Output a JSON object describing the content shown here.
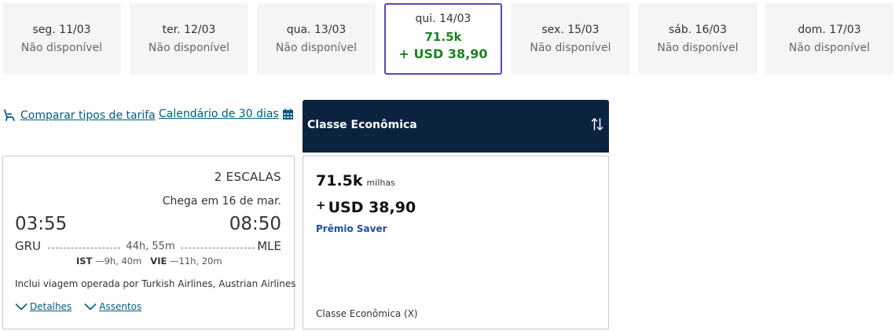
{
  "dates": [
    {
      "label": "seg. 11/03",
      "status": "Não disponível"
    },
    {
      "label": "ter. 12/03",
      "status": "Não disponível"
    },
    {
      "label": "qua. 13/03",
      "status": "Não disponível"
    },
    {
      "label": "qui. 14/03",
      "miles": "71.5k",
      "price": "+ USD 38,90",
      "selected": true
    },
    {
      "label": "sex. 15/03",
      "status": "Não disponível"
    },
    {
      "label": "sáb. 16/03",
      "status": "Não disponível"
    },
    {
      "label": "dom. 17/03",
      "status": "Não disponível"
    }
  ],
  "links": {
    "compare": "Comparar tipos de tarifa",
    "calendar": "Calendário de 30 dias"
  },
  "flight": {
    "stops": "2 ESCALAS",
    "arrives": "Chega em 16 de mar.",
    "depart_time": "03:55",
    "arrive_time": "08:50",
    "origin": "GRU",
    "destination": "MLE",
    "duration": "44h, 55m",
    "layover1_code": "IST",
    "layover1_time": "9h, 40m",
    "layover2_code": "VIE",
    "layover2_time": "11h, 20m",
    "operated_by": "Inclui viagem operada por Turkish Airlines, Austrian Airlines",
    "details_label": "Detalhes",
    "seats_label": "Assentos"
  },
  "fare": {
    "header": "Classe Econômica",
    "miles": "71.5k",
    "miles_unit": "milhas",
    "plus": "+",
    "price": "USD 38,90",
    "type": "Prêmio Saver",
    "class_label": "Classe Econômica (X)"
  },
  "colors": {
    "accent_selected": "#6244bb",
    "price_green": "#208020",
    "header_navy": "#0c2340",
    "link_teal": "#005c80"
  },
  "icons": {
    "seat": "seat-icon",
    "calendar": "calendar-icon",
    "sort": "sort-icon",
    "chevron": "chevron-down-icon"
  }
}
